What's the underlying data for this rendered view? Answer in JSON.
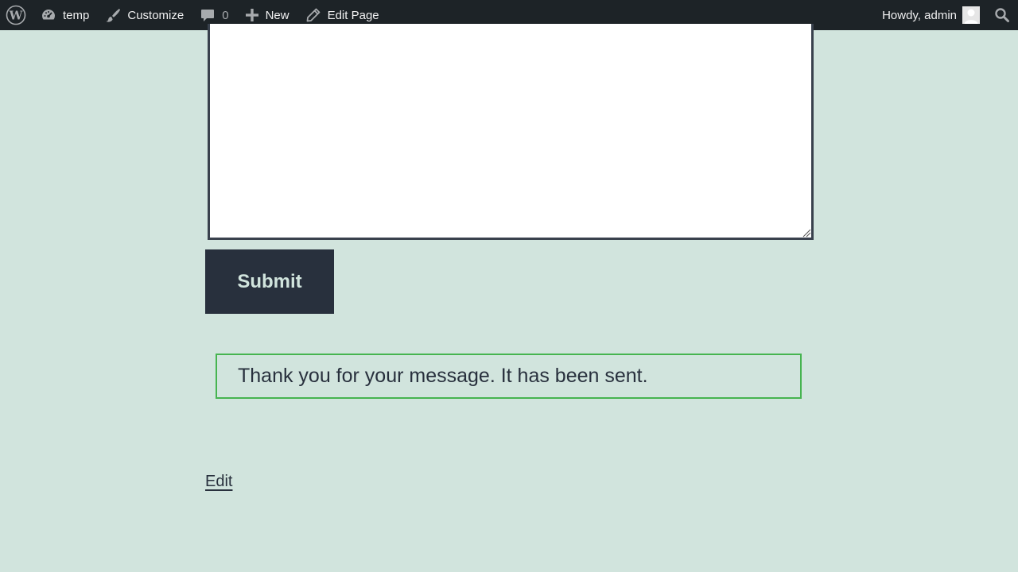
{
  "adminbar": {
    "site_name": "temp",
    "customize_label": "Customize",
    "comments_count": "0",
    "new_label": "New",
    "edit_page_label": "Edit Page",
    "howdy_label": "Howdy, admin",
    "icons": {
      "logo": "wordpress-icon",
      "site": "dashboard-icon",
      "customize": "paintbrush-icon",
      "comments": "comment-icon",
      "new": "plus-icon",
      "edit": "pencil-icon",
      "search": "search-icon"
    }
  },
  "form": {
    "message_value": "",
    "submit_label": "Submit"
  },
  "notice": {
    "message": "Thank you for your message. It has been sent."
  },
  "footer": {
    "edit_label": "Edit"
  },
  "colors": {
    "background": "#d1e4dd",
    "adminbar": "#1d2327",
    "button": "#28303d",
    "success_border": "#46b450"
  }
}
